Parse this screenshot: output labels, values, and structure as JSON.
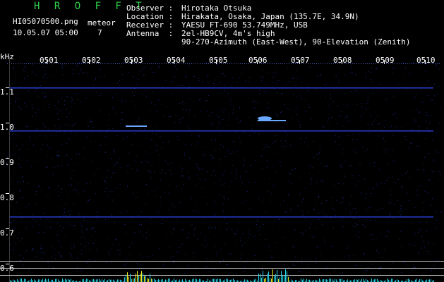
{
  "header": {
    "app_title": "H R O F F T",
    "filename": "HI05070500.png",
    "datetime": "10.05.07 05:00",
    "meteor_label": "meteor",
    "meteor_count": "7"
  },
  "info": {
    "observer_key": "Observer :",
    "observer_val": "Hirotaka Otsuka",
    "location_key": "Location :",
    "location_val": "Hirakata, Osaka, Japan (135.7E, 34.9N)",
    "receiver_key": "Receiver :",
    "receiver_val": "YAESU FT-690 53.749MHz, USB",
    "antenna_key": "Antenna  :",
    "antenna_val1": "2el-HB9CV, 4m's high",
    "antenna_val2": "90-270-Azimuth (East-West), 90-Elevation (Zenith)"
  },
  "axis": {
    "unit": "kHz",
    "x_ticks": [
      "0501",
      "0502",
      "0503",
      "0504",
      "0505",
      "0506",
      "0507",
      "0508",
      "0509",
      "0510"
    ],
    "y_ticks": [
      "1.1",
      "1.0",
      "0.9",
      "0.8",
      "0.7",
      "0.6"
    ]
  },
  "colors": {
    "background": "#000000",
    "title": "#2fd34a",
    "noise_dot": "#1a2a8a",
    "carrier_line": "#2a3fd8",
    "grid_white": "#c8c8c8",
    "echo": "#6aa8ff",
    "bars_cyan": "#22d5e8",
    "bars_yellow": "#f0f020"
  }
}
